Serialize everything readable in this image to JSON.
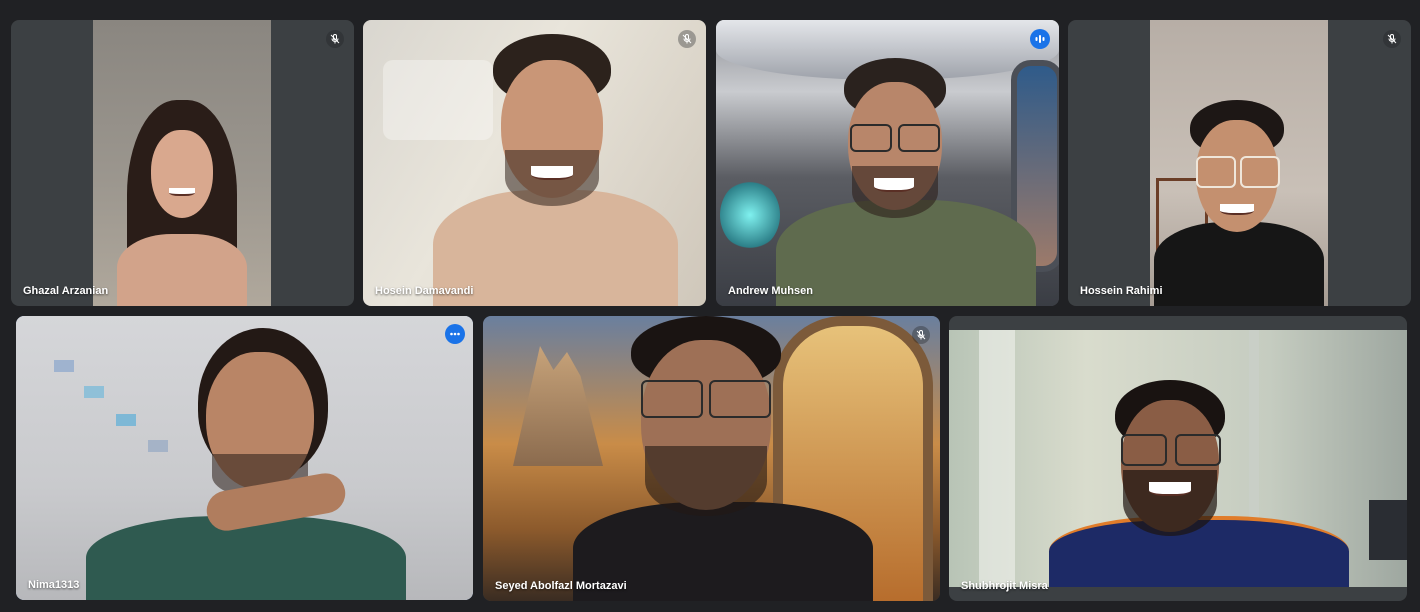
{
  "participants": [
    {
      "name": "Ghazal Arzanian",
      "status": "muted"
    },
    {
      "name": "Hosein Damavandi",
      "status": "muted"
    },
    {
      "name": "Andrew Muhsen",
      "status": "speaking"
    },
    {
      "name": "Hossein Rahimi",
      "status": "muted"
    },
    {
      "name": "Nima1313",
      "status": "more-options"
    },
    {
      "name": "Seyed Abolfazl Mortazavi",
      "status": "muted"
    },
    {
      "name": "Shubhrojit Misra",
      "status": "unmuted"
    }
  ],
  "colors": {
    "background": "#202124",
    "tile_background": "#3c4043",
    "active_border": "#8ab4f8",
    "badge_blue": "#1a73e8"
  },
  "icons": {
    "mic_off": "mic-off-icon",
    "speaking": "audio-level-icon",
    "more": "more-options-icon"
  }
}
